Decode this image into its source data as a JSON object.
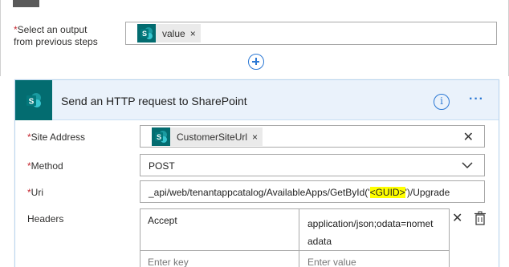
{
  "previous_step": {
    "select_label_line1": "Select an output",
    "select_label_line2": "from previous steps",
    "required_mark": "*",
    "token": {
      "text": "value",
      "remove": "×",
      "icon": "sharepoint-icon"
    }
  },
  "add_step": {
    "icon": "plus-circle-icon"
  },
  "action": {
    "title": "Send an HTTP request to SharePoint",
    "icon": "sharepoint-icon",
    "info_glyph": "i",
    "more_glyph": "···",
    "colors": {
      "header_bg": "#eaf2fb",
      "icon_bg": "#036c70",
      "accent": "#2b78d4",
      "required": "#c4262e",
      "highlight": "#ffff00"
    }
  },
  "fields": {
    "site_address": {
      "label": "Site Address",
      "required": "*",
      "token_text": "CustomerSiteUrl",
      "token_remove": "×",
      "clear": "✕"
    },
    "method": {
      "label": "Method",
      "required": "*",
      "value": "POST"
    },
    "uri": {
      "label": "Uri",
      "required": "*",
      "value_prefix": "_api/web/tenantappcatalog/AvailableApps/GetById('",
      "value_highlight": "<GUID>",
      "value_suffix": "')/Upgrade"
    },
    "headers": {
      "label": "Headers",
      "key": "Accept",
      "value_line1": "application/json;odata=nomet",
      "value_line2": "adata",
      "key_placeholder": "Enter key",
      "value_placeholder": "Enter value",
      "remove": "✕"
    }
  }
}
